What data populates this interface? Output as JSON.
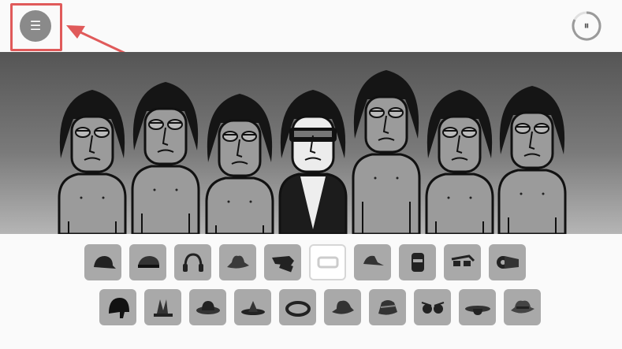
{
  "topbar": {
    "menu_icon": "hamburger-icon",
    "menu_glyph": "☰",
    "pause_icon": "pause-icon",
    "pause_glyph": "⏸",
    "highlight_color": "#e05a5a"
  },
  "stage": {
    "characters": [
      {
        "role": "singer",
        "accessory": "none"
      },
      {
        "role": "singer",
        "accessory": "none"
      },
      {
        "role": "singer",
        "accessory": "none"
      },
      {
        "role": "performer",
        "accessory": "sunglasses-jacket"
      },
      {
        "role": "singer",
        "accessory": "none"
      },
      {
        "role": "singer",
        "accessory": "none"
      },
      {
        "role": "singer",
        "accessory": "none"
      }
    ]
  },
  "tray": {
    "row1": [
      "cap-icon",
      "beret-cap-icon",
      "headphones-icon",
      "fedora-icon",
      "sunglasses-icon",
      "empty-slot",
      "visor-cap-icon",
      "mask-icon",
      "goggles-icon",
      "tape-icon"
    ],
    "row2": [
      "helmet-icon",
      "crown-band-icon",
      "bowler-hat-icon",
      "pointed-hat-icon",
      "ring-hat-icon",
      "trilby-hat-icon",
      "striped-hat-icon",
      "glasses-icon",
      "wide-brim-hat-icon",
      "cowboy-hat-icon"
    ]
  },
  "colors": {
    "item_bg": "#a9a9a9",
    "stage_dark": "#555555",
    "page_bg": "#fafafa"
  }
}
